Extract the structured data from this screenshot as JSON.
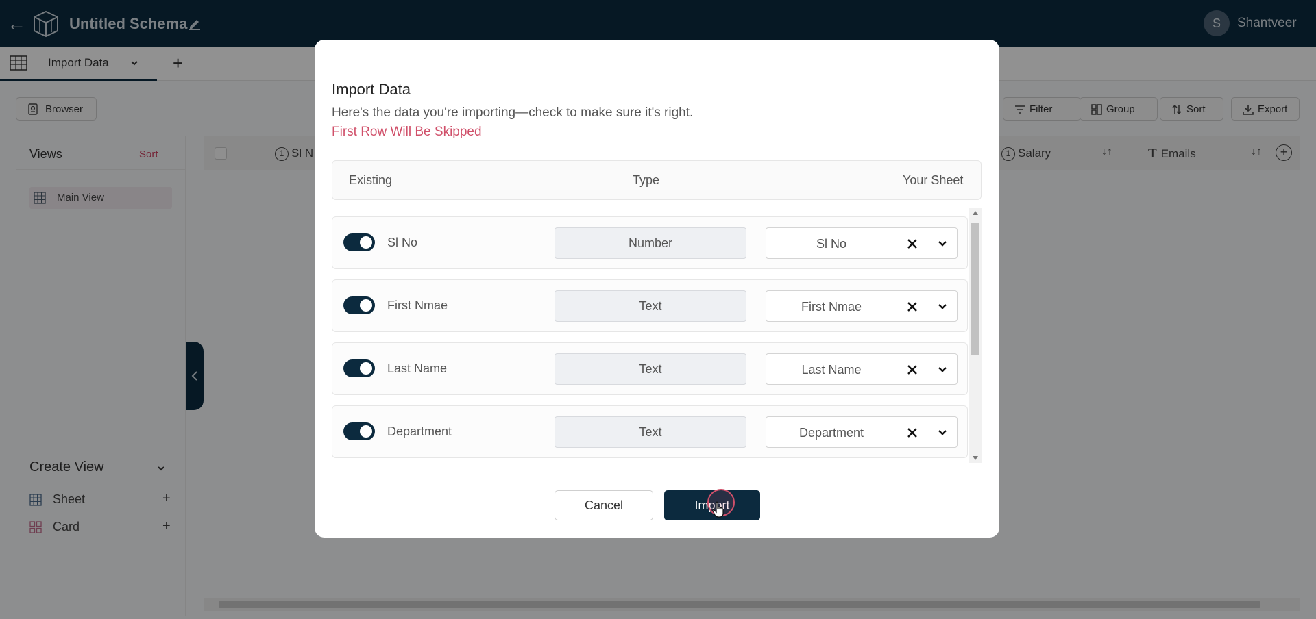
{
  "app": {
    "title": "Untitled Schema",
    "user_initial": "S",
    "user_name": "Shantveer"
  },
  "tabs": {
    "active_label": "Import Data",
    "add": "+"
  },
  "toolbar": {
    "browser": "Browser",
    "filter": "Filter",
    "group": "Group",
    "sort": "Sort",
    "export": "Export"
  },
  "sidebar": {
    "views_title": "Views",
    "views_sort": "Sort",
    "main_view": "Main View",
    "create_view_title": "Create View",
    "create_items": [
      {
        "label": "Sheet",
        "add": "+"
      },
      {
        "label": "Card",
        "add": "+"
      }
    ]
  },
  "grid": {
    "columns": [
      {
        "icon": "1",
        "label": "Sl N"
      },
      {
        "icon": "1",
        "label": "Salary"
      },
      {
        "icon": "T",
        "label": "Emails"
      }
    ],
    "sort_glyph": "↓↑",
    "add_col": "+"
  },
  "modal": {
    "title": "Import Data",
    "subtitle": "Here's the data you're importing—check to make sure it's right.",
    "warning": "First Row Will Be Skipped",
    "headers": {
      "existing": "Existing",
      "type": "Type",
      "sheet": "Your Sheet"
    },
    "rows": [
      {
        "enabled": true,
        "name": "Sl No",
        "type": "Number",
        "sheet": "Sl No"
      },
      {
        "enabled": true,
        "name": "First Nmae",
        "type": "Text",
        "sheet": "First Nmae"
      },
      {
        "enabled": true,
        "name": "Last Name",
        "type": "Text",
        "sheet": "Last Name"
      },
      {
        "enabled": true,
        "name": "Department",
        "type": "Text",
        "sheet": "Department"
      }
    ],
    "cancel": "Cancel",
    "import": "Import"
  },
  "colors": {
    "primary": "#0c2a3e",
    "accent": "#d0506a"
  }
}
